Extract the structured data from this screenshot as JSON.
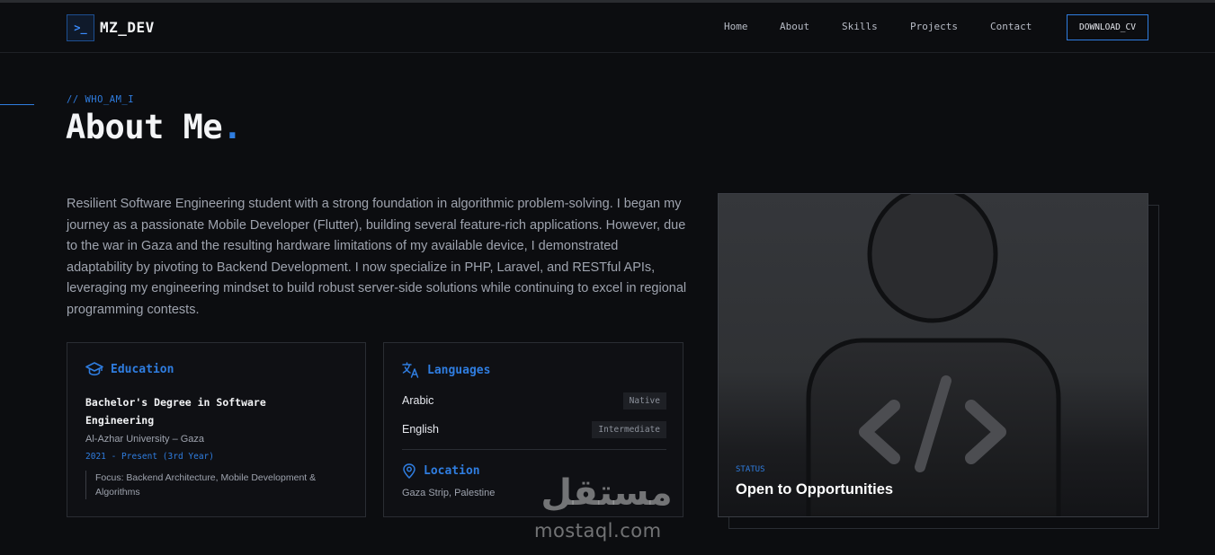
{
  "brand": {
    "logo_glyph": ">_",
    "name": "MZ_DEV"
  },
  "nav": {
    "links": [
      "Home",
      "About",
      "Skills",
      "Projects",
      "Contact"
    ],
    "cta": "DOWNLOAD_CV"
  },
  "section": {
    "eyebrow": "// WHO_AM_I",
    "title": "About Me",
    "title_dot": ".",
    "bio": "Resilient Software Engineering student with a strong foundation in algorithmic problem-solving. I began my journey as a passionate Mobile Developer (Flutter), building several feature-rich applications. However, due to the war in Gaza and the resulting hardware limitations of my available device, I demonstrated adaptability by pivoting to Backend Development. I now specialize in PHP, Laravel, and RESTful APIs, leveraging my engineering mindset to build robust server-side solutions while continuing to excel in regional programming contests."
  },
  "education": {
    "heading": "Education",
    "icon": "graduation-cap-icon",
    "degree": "Bachelor's Degree in Software Engineering",
    "university": "Al-Azhar University – Gaza",
    "dates": "2021 - Present (3rd Year)",
    "focus": "Focus: Backend Architecture, Mobile Development & Algorithms"
  },
  "languages": {
    "heading": "Languages",
    "icon": "translate-icon",
    "items": [
      {
        "name": "Arabic",
        "level": "Native"
      },
      {
        "name": "English",
        "level": "Intermediate"
      }
    ],
    "location_heading": "Location",
    "location_icon": "map-pin-icon",
    "location": "Gaza Strip, Palestine"
  },
  "profile": {
    "status_label": "STATUS",
    "status": "Open to Opportunities"
  },
  "watermark": {
    "arabic": "مستقل",
    "latin": "mostaql.com"
  },
  "colors": {
    "accent": "#2f7de0",
    "background": "#0c0d10",
    "card": "#0f1014",
    "muted_text": "#9ea3ae"
  }
}
